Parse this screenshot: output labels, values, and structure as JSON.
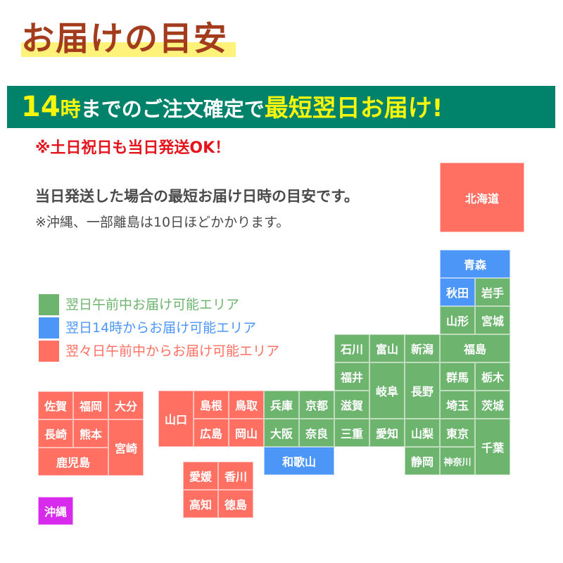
{
  "header": {
    "title": "お届けの目安"
  },
  "banner": {
    "part_hour": "14",
    "part_hour_suffix": "時",
    "part_middle": "までのご注文確定で",
    "part_emphasis": "最短翌日お届け!"
  },
  "notice_weekend": "※土日祝日も当日発送OK！",
  "description": {
    "main": "当日発送した場合の最短お届け日時の目安です。",
    "note": "※沖縄、一部離島は10日ほどかかります。"
  },
  "colors": {
    "green": "#6db46f",
    "blue": "#4c96f7",
    "red": "#ff6f62",
    "purple": "#d82aec",
    "title": "#a33c1c",
    "banner": "#00826b"
  },
  "legend": [
    {
      "label": "翌日午前中お届け可能エリア",
      "category": "green"
    },
    {
      "label": "翌日14時からお届け可能エリア",
      "category": "blue"
    },
    {
      "label": "翌々日午前中からお届け可能エリア",
      "category": "red"
    }
  ],
  "prefectures": {
    "hokkaido": {
      "name": "北海道",
      "category": "red"
    },
    "aomori": {
      "name": "青森",
      "category": "blue"
    },
    "akita": {
      "name": "秋田",
      "category": "blue"
    },
    "iwate": {
      "name": "岩手",
      "category": "green"
    },
    "yamagata": {
      "name": "山形",
      "category": "green"
    },
    "miyagi": {
      "name": "宮城",
      "category": "green"
    },
    "ishikawa": {
      "name": "石川",
      "category": "green"
    },
    "toyama": {
      "name": "富山",
      "category": "green"
    },
    "niigata": {
      "name": "新潟",
      "category": "green"
    },
    "fukushima": {
      "name": "福島",
      "category": "green"
    },
    "fukui": {
      "name": "福井",
      "category": "green"
    },
    "gifu": {
      "name": "岐阜",
      "category": "green"
    },
    "nagano": {
      "name": "長野",
      "category": "green"
    },
    "gunma": {
      "name": "群馬",
      "category": "green"
    },
    "tochigi": {
      "name": "栃木",
      "category": "green"
    },
    "shiga": {
      "name": "滋賀",
      "category": "green"
    },
    "saitama": {
      "name": "埼玉",
      "category": "green"
    },
    "ibaraki": {
      "name": "茨城",
      "category": "green"
    },
    "mie": {
      "name": "三重",
      "category": "green"
    },
    "aichi": {
      "name": "愛知",
      "category": "green"
    },
    "yamanashi": {
      "name": "山梨",
      "category": "green"
    },
    "tokyo": {
      "name": "東京",
      "category": "green"
    },
    "chiba": {
      "name": "千葉",
      "category": "green"
    },
    "shizuoka": {
      "name": "静岡",
      "category": "green"
    },
    "kanagawa": {
      "name": "神奈川",
      "category": "green"
    },
    "hyogo": {
      "name": "兵庫",
      "category": "green"
    },
    "kyoto": {
      "name": "京都",
      "category": "green"
    },
    "osaka": {
      "name": "大阪",
      "category": "green"
    },
    "nara": {
      "name": "奈良",
      "category": "green"
    },
    "wakayama": {
      "name": "和歌山",
      "category": "blue"
    },
    "yamaguchi": {
      "name": "山口",
      "category": "red"
    },
    "shimane": {
      "name": "島根",
      "category": "red"
    },
    "tottori": {
      "name": "鳥取",
      "category": "red"
    },
    "hiroshima": {
      "name": "広島",
      "category": "red"
    },
    "okayama": {
      "name": "岡山",
      "category": "red"
    },
    "saga": {
      "name": "佐賀",
      "category": "red"
    },
    "fukuoka": {
      "name": "福岡",
      "category": "red"
    },
    "oita": {
      "name": "大分",
      "category": "red"
    },
    "nagasaki": {
      "name": "長崎",
      "category": "red"
    },
    "kumamoto": {
      "name": "熊本",
      "category": "red"
    },
    "miyazaki": {
      "name": "宮崎",
      "category": "red"
    },
    "kagoshima": {
      "name": "鹿児島",
      "category": "red"
    },
    "ehime": {
      "name": "愛媛",
      "category": "red"
    },
    "kagawa": {
      "name": "香川",
      "category": "red"
    },
    "kochi": {
      "name": "高知",
      "category": "red"
    },
    "tokushima": {
      "name": "徳島",
      "category": "red"
    },
    "okinawa": {
      "name": "沖縄",
      "category": "purple"
    }
  }
}
